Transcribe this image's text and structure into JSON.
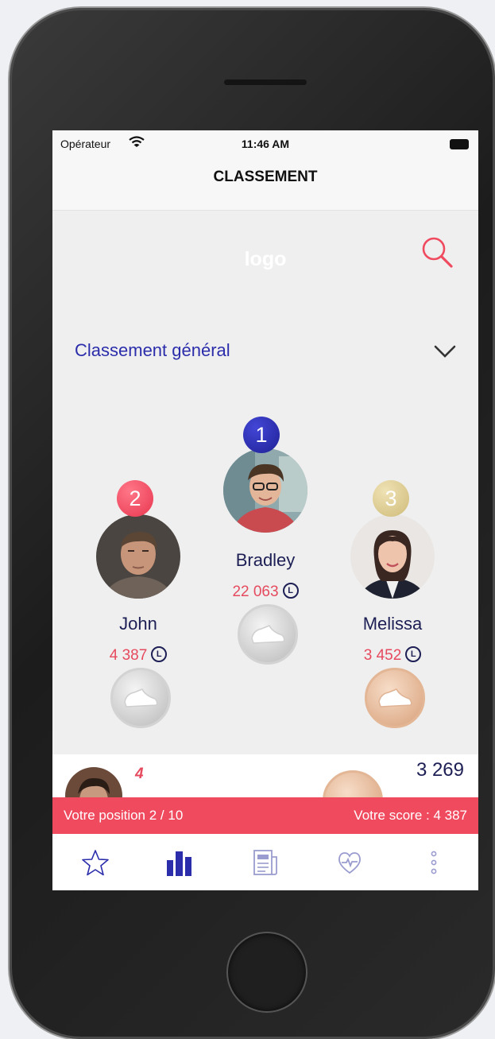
{
  "status": {
    "carrier": "Opérateur",
    "time": "11:46 AM"
  },
  "header": {
    "title": "CLASSEMENT"
  },
  "brand": {
    "logo": "logo",
    "accent": "#f04a5f",
    "primary": "#2b2dab"
  },
  "filter": {
    "label": "Classement général"
  },
  "podium": [
    {
      "rank": "1",
      "name": "Bradley",
      "score": "22 063",
      "unit": "L",
      "badge_color": "#2a2cb5",
      "medal": "silver"
    },
    {
      "rank": "2",
      "name": "John",
      "score": "4 387",
      "unit": "L",
      "badge_color": "#f04a5f",
      "medal": "silver"
    },
    {
      "rank": "3",
      "name": "Melissa",
      "score": "3 452",
      "unit": "L",
      "badge_color": "#dcc989",
      "medal": "bronze"
    }
  ],
  "next_row": {
    "rank": "4",
    "score": "3 269"
  },
  "footer": {
    "position": "Votre position 2 / 10",
    "score": "Votre score : 4 387"
  },
  "tabs": [
    {
      "icon": "star-icon",
      "active": false
    },
    {
      "icon": "leaderboard-icon",
      "active": true
    },
    {
      "icon": "news-icon",
      "active": false
    },
    {
      "icon": "health-icon",
      "active": false
    },
    {
      "icon": "more-icon",
      "active": false
    }
  ]
}
